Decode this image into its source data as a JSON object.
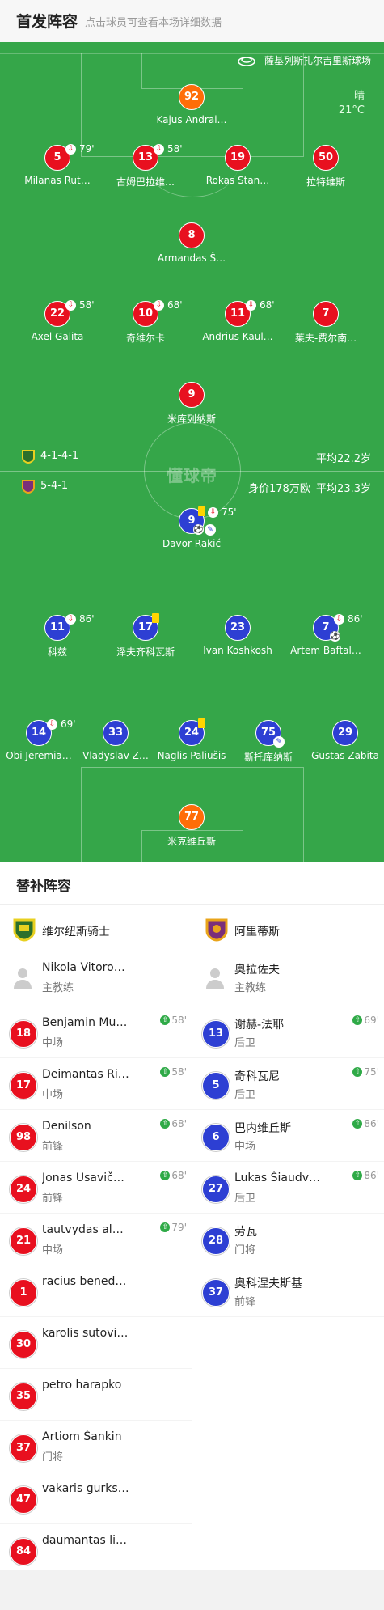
{
  "header": {
    "title": "首发阵容",
    "subtitle": "点击球员可查看本场详细数据"
  },
  "pitch": {
    "stadium": "薩基列斯扎尔吉里斯球场",
    "weather": "晴",
    "temperature": "21°C",
    "watermark": "懂球帝",
    "home_formation": "4-1-4-1",
    "home_avg_age": "平均22.2岁",
    "away_formation": "5-4-1",
    "away_value": "身价178万欧",
    "away_avg_age": "平均23.3岁",
    "colors": {
      "home": "#e8101f",
      "away": "#2d3fd3",
      "keeper_home": "#ff6d08",
      "pitch": "#35a649"
    }
  },
  "home_players": [
    {
      "num": "92",
      "name": "Kajus Andrai…",
      "keeper": true
    },
    {
      "num": "5",
      "name": "Milanas Rut…",
      "sub": "79'"
    },
    {
      "num": "13",
      "name": "古姆巴拉维…",
      "sub": "58'"
    },
    {
      "num": "19",
      "name": "Rokas Stan…"
    },
    {
      "num": "50",
      "name": "拉特维斯"
    },
    {
      "num": "8",
      "name": "Armandas Š…"
    },
    {
      "num": "22",
      "name": "Axel Galita",
      "sub": "58'"
    },
    {
      "num": "10",
      "name": "奇维尔卡",
      "sub": "68'"
    },
    {
      "num": "11",
      "name": "Andrius Kaul…",
      "sub": "68'"
    },
    {
      "num": "7",
      "name": "莱夫-费尔南…"
    },
    {
      "num": "9",
      "name": "米库列纳斯"
    }
  ],
  "away_players": [
    {
      "num": "9",
      "name": "Davor Rakić",
      "sub": "75'"
    },
    {
      "num": "11",
      "name": "科兹",
      "sub": "86'"
    },
    {
      "num": "17",
      "name": "泽夫齐科瓦斯"
    },
    {
      "num": "23",
      "name": "Ivan Koshkosh"
    },
    {
      "num": "7",
      "name": "Artem Baftal…",
      "sub": "86'"
    },
    {
      "num": "14",
      "name": "Obi Jeremia…",
      "sub": "69'"
    },
    {
      "num": "33",
      "name": "Vladyslav Z…"
    },
    {
      "num": "24",
      "name": "Naglis Paliušis"
    },
    {
      "num": "75",
      "name": "斯托库纳斯"
    },
    {
      "num": "29",
      "name": "Gustas Zabita"
    },
    {
      "num": "77",
      "name": "米克维丘斯",
      "keeper": true
    }
  ],
  "bench": {
    "title": "替补阵容",
    "home": {
      "team": "维尔纽斯骑士",
      "coach": {
        "name": "Nikola Vitorovic",
        "role": "主教练"
      },
      "subs": [
        {
          "num": "18",
          "name": "Benjamin Mul…",
          "pos": "中场",
          "min": "58'"
        },
        {
          "num": "17",
          "name": "Deimantas Ri…",
          "pos": "中场",
          "min": "58'"
        },
        {
          "num": "98",
          "name": "Denilson",
          "pos": "前锋",
          "min": "68'"
        },
        {
          "num": "24",
          "name": "Jonas Usavič…",
          "pos": "前锋",
          "min": "68'"
        },
        {
          "num": "21",
          "name": "tautvydas ale…",
          "pos": "中场",
          "min": "79'"
        },
        {
          "num": "1",
          "name": "racius benedi…",
          "pos": "",
          "min": ""
        },
        {
          "num": "30",
          "name": "karolis sutovi…",
          "pos": "",
          "min": ""
        },
        {
          "num": "35",
          "name": "petro harapko",
          "pos": "",
          "min": ""
        },
        {
          "num": "37",
          "name": "Artiom Šankin",
          "pos": "门将",
          "min": ""
        },
        {
          "num": "47",
          "name": "vakaris gurks…",
          "pos": "",
          "min": ""
        },
        {
          "num": "84",
          "name": "daumantas lip…",
          "pos": "",
          "min": ""
        }
      ]
    },
    "away": {
      "team": "阿里蒂斯",
      "coach": {
        "name": "奥拉佐夫",
        "role": "主教练"
      },
      "subs": [
        {
          "num": "13",
          "name": "谢赫-法耶",
          "pos": "后卫",
          "min": "69'"
        },
        {
          "num": "5",
          "name": "奇科瓦尼",
          "pos": "后卫",
          "min": "75'"
        },
        {
          "num": "6",
          "name": "巴内维丘斯",
          "pos": "中场",
          "min": "86'"
        },
        {
          "num": "27",
          "name": "Lukas Šiaudv…",
          "pos": "后卫",
          "min": "86'"
        },
        {
          "num": "28",
          "name": "劳瓦",
          "pos": "门将",
          "min": ""
        },
        {
          "num": "37",
          "name": "奥科涅夫斯基",
          "pos": "前锋",
          "min": ""
        }
      ]
    }
  }
}
